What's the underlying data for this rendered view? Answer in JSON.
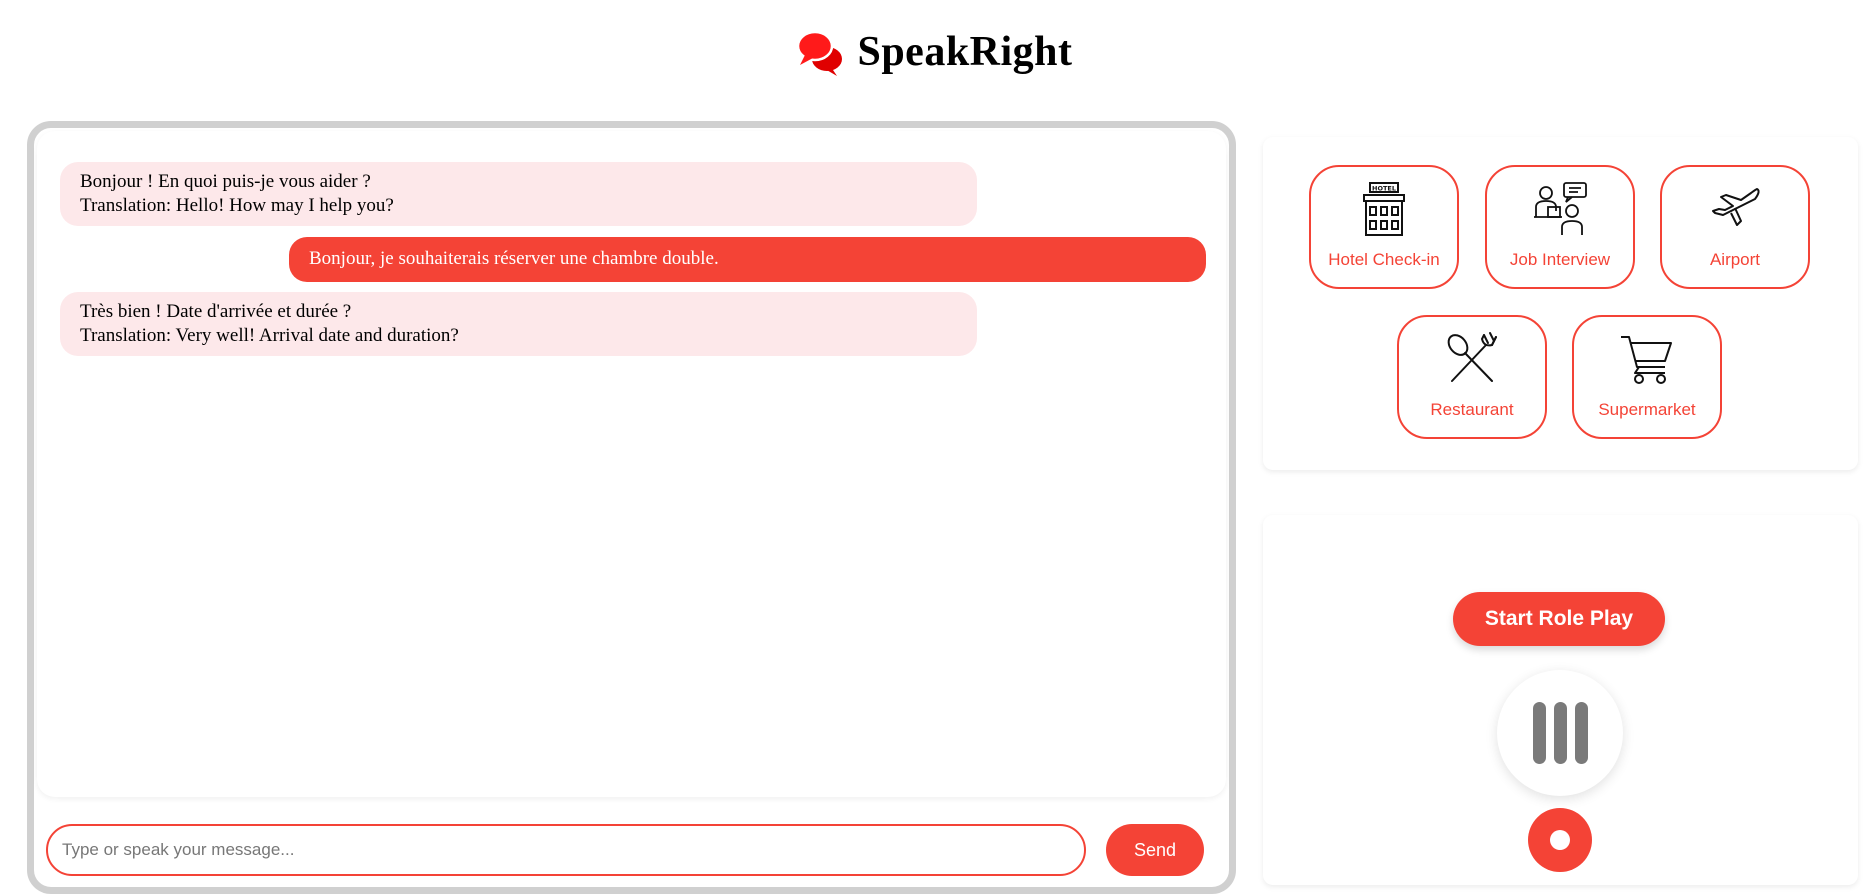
{
  "app": {
    "title": "SpeakRight",
    "accent_color": "#f44336",
    "logo_icon": "speech-bubbles-icon"
  },
  "chat": {
    "messages": [
      {
        "role": "bot",
        "lines": [
          "Bonjour ! En quoi puis-je vous aider ?",
          "Translation: Hello! How may I help you?"
        ]
      },
      {
        "role": "user",
        "lines": [
          "Bonjour, je souhaiterais réserver une chambre double."
        ]
      },
      {
        "role": "bot",
        "lines": [
          "Très bien ! Date d'arrivée et durée ?",
          "Translation: Very well! Arrival date and duration?"
        ]
      }
    ],
    "input_placeholder": "Type or speak your message...",
    "input_value": "",
    "send_label": "Send"
  },
  "scenarios": [
    {
      "label": "Hotel Check-in",
      "icon": "hotel-icon",
      "sign": "HOTEL"
    },
    {
      "label": "Job Interview",
      "icon": "job-interview-icon"
    },
    {
      "label": "Airport",
      "icon": "airplane-icon"
    },
    {
      "label": "Restaurant",
      "icon": "fork-spoon-icon"
    },
    {
      "label": "Supermarket",
      "icon": "shopping-cart-icon"
    }
  ],
  "controls": {
    "start_label": "Start Role Play",
    "mic_icon": "audio-bars-icon",
    "record_icon": "record-icon"
  }
}
